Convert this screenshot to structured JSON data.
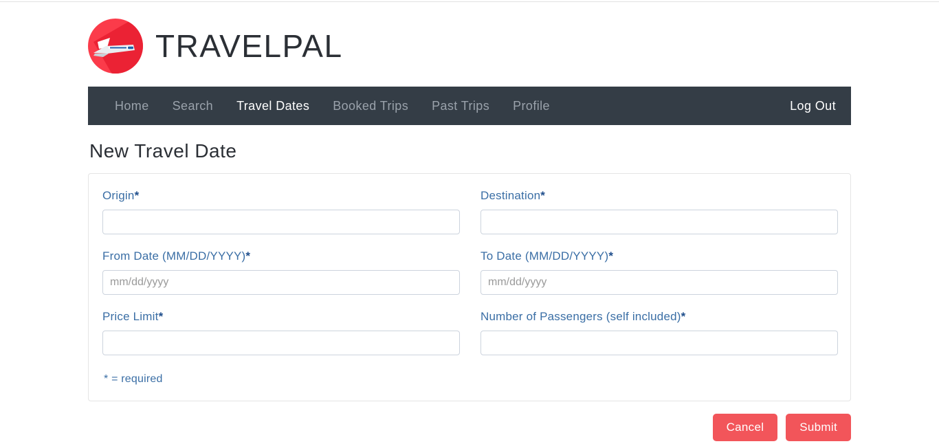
{
  "brand": {
    "name": "TRAVELPAL",
    "logo_icon": "airplane-circle-icon",
    "logo_color": "#fb3b4a"
  },
  "nav": {
    "background_color": "#343d46",
    "items": [
      {
        "label": "Home",
        "active": false
      },
      {
        "label": "Search",
        "active": false
      },
      {
        "label": "Travel Dates",
        "active": true
      },
      {
        "label": "Booked Trips",
        "active": false
      },
      {
        "label": "Past Trips",
        "active": false
      },
      {
        "label": "Profile",
        "active": false
      }
    ],
    "logout_label": "Log Out"
  },
  "page": {
    "title": "New Travel Date"
  },
  "form": {
    "fields": [
      {
        "label": "Origin",
        "required_marker": "*",
        "value": "",
        "placeholder": "",
        "type": "text"
      },
      {
        "label": "Destination",
        "required_marker": "*",
        "value": "",
        "placeholder": "",
        "type": "text"
      },
      {
        "label": "From Date (MM/DD/YYYY)",
        "required_marker": "*",
        "value": "",
        "placeholder": "mm/dd/yyyy",
        "type": "date"
      },
      {
        "label": "To Date (MM/DD/YYYY)",
        "required_marker": "*",
        "value": "",
        "placeholder": "mm/dd/yyyy",
        "type": "date"
      },
      {
        "label": "Price Limit",
        "required_marker": "*",
        "value": "",
        "placeholder": "",
        "type": "text"
      },
      {
        "label": "Number of Passengers (self included)",
        "required_marker": "*",
        "value": "",
        "placeholder": "",
        "type": "text"
      }
    ],
    "required_note": "* = required"
  },
  "actions": {
    "cancel_label": "Cancel",
    "submit_label": "Submit",
    "button_color": "#f2555a"
  }
}
